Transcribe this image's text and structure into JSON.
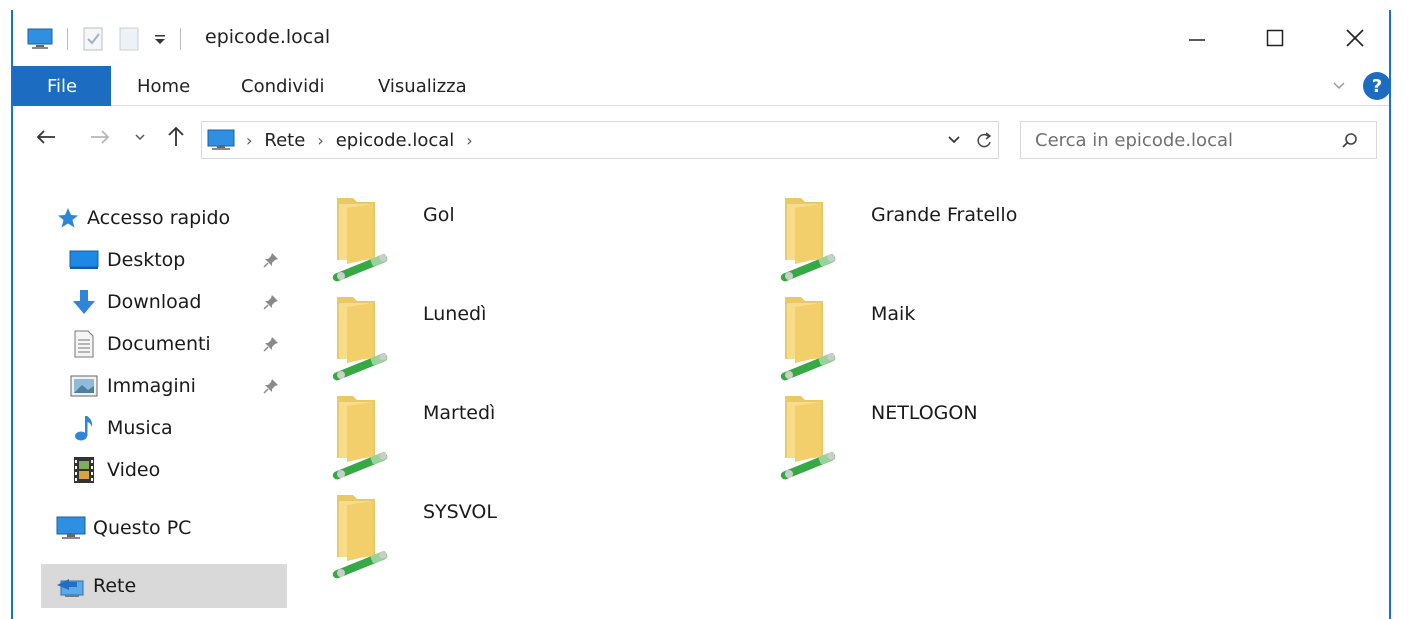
{
  "window": {
    "title": "epicode.local"
  },
  "ribbon": {
    "tabs": [
      {
        "label": "File"
      },
      {
        "label": "Home"
      },
      {
        "label": "Condividi"
      },
      {
        "label": "Visualizza"
      }
    ]
  },
  "address": {
    "crumbs": [
      "Rete",
      "epicode.local"
    ],
    "search_placeholder": "Cerca in epicode.local"
  },
  "navpane": {
    "quick_access": "Accesso rapido",
    "items": [
      {
        "label": "Desktop",
        "pinned": true
      },
      {
        "label": "Download",
        "pinned": true
      },
      {
        "label": "Documenti",
        "pinned": true
      },
      {
        "label": "Immagini",
        "pinned": true
      },
      {
        "label": "Musica",
        "pinned": false
      },
      {
        "label": "Video",
        "pinned": false
      }
    ],
    "this_pc": "Questo PC",
    "network": "Rete"
  },
  "content": {
    "shares": [
      {
        "name": "Gol"
      },
      {
        "name": "Grande Fratello"
      },
      {
        "name": "Lunedì"
      },
      {
        "name": "Maik"
      },
      {
        "name": "Martedì"
      },
      {
        "name": "NETLOGON"
      },
      {
        "name": "SYSVOL"
      }
    ]
  },
  "colors": {
    "accent": "#1c6dc2",
    "selection": "#d9d9d9",
    "folder": "#f5d77a",
    "share_pipe": "#3cae47"
  }
}
